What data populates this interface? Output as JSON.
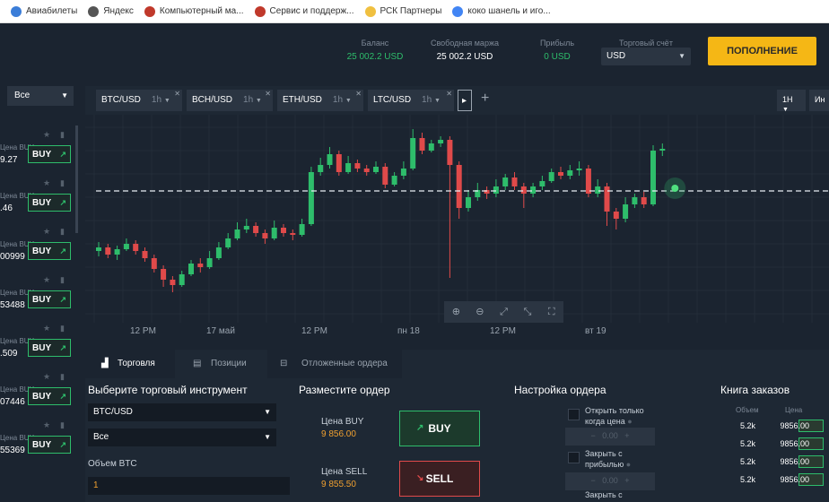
{
  "bookmarks": [
    {
      "label": "Авиабилеты",
      "color": "#3b7dd8"
    },
    {
      "label": "Яндекс",
      "color": "#555555"
    },
    {
      "label": "Компьютерный ма...",
      "color": "#c0392b"
    },
    {
      "label": "Сервис и поддерж...",
      "color": "#c0392b"
    },
    {
      "label": "РСК Партнеры",
      "color": "#f0c040"
    },
    {
      "label": "коко шанель и иго...",
      "color": "#4285f4"
    }
  ],
  "header": {
    "balance_label": "Баланс",
    "balance": "25 002.2 USD",
    "free_margin_label": "Свободная маржа",
    "free_margin": "25 002.2 USD",
    "profit_label": "Прибыль",
    "profit": "0 USD",
    "account_label": "Торговый счёт",
    "account": "USD",
    "topup": "ПОПОЛНЕНИЕ"
  },
  "left": {
    "filter": "Все",
    "rows": [
      {
        "label": "Цена BUY",
        "price": "9.27",
        "btn": "BUY"
      },
      {
        "label": "Цена BUY",
        "price": ".46",
        "btn": "BUY"
      },
      {
        "label": "Цена BUY",
        "price": "00999",
        "btn": "BUY"
      },
      {
        "label": "Цена BUY",
        "price": "53488",
        "btn": "BUY"
      },
      {
        "label": "Цена BUY",
        "price": ".509",
        "btn": "BUY"
      },
      {
        "label": "Цена BUY",
        "price": "07446",
        "btn": "BUY"
      },
      {
        "label": "Цена BUY",
        "price": "55369",
        "btn": "BUY"
      }
    ]
  },
  "chart_tabs": [
    {
      "pair": "BTC/USD",
      "tf": "1h"
    },
    {
      "pair": "BCH/USD",
      "tf": "1h"
    },
    {
      "pair": "ETH/USD",
      "tf": "1h"
    },
    {
      "pair": "LTC/USD",
      "tf": "1h"
    }
  ],
  "chart_right": {
    "tf": "1H",
    "ind": "Ин"
  },
  "chart_data": {
    "type": "candlestick",
    "x_ticks": [
      "12 PM",
      "17 май",
      "12 PM",
      "пн 18",
      "12 PM",
      "вт 19"
    ],
    "current_line": true,
    "candles": [
      [
        0.4,
        0.42,
        0.37,
        0.45
      ],
      [
        0.42,
        0.38,
        0.36,
        0.44
      ],
      [
        0.38,
        0.41,
        0.35,
        0.43
      ],
      [
        0.41,
        0.44,
        0.4,
        0.47
      ],
      [
        0.44,
        0.4,
        0.38,
        0.46
      ],
      [
        0.4,
        0.36,
        0.34,
        0.42
      ],
      [
        0.36,
        0.3,
        0.28,
        0.38
      ],
      [
        0.3,
        0.24,
        0.2,
        0.32
      ],
      [
        0.24,
        0.21,
        0.17,
        0.26
      ],
      [
        0.21,
        0.27,
        0.2,
        0.29
      ],
      [
        0.27,
        0.33,
        0.26,
        0.35
      ],
      [
        0.33,
        0.31,
        0.28,
        0.36
      ],
      [
        0.31,
        0.36,
        0.3,
        0.4
      ],
      [
        0.36,
        0.42,
        0.35,
        0.45
      ],
      [
        0.42,
        0.47,
        0.41,
        0.5
      ],
      [
        0.47,
        0.52,
        0.46,
        0.56
      ],
      [
        0.52,
        0.54,
        0.5,
        0.58
      ],
      [
        0.54,
        0.5,
        0.48,
        0.56
      ],
      [
        0.5,
        0.47,
        0.44,
        0.52
      ],
      [
        0.47,
        0.53,
        0.46,
        0.57
      ],
      [
        0.53,
        0.5,
        0.48,
        0.55
      ],
      [
        0.5,
        0.49,
        0.46,
        0.52
      ],
      [
        0.49,
        0.55,
        0.48,
        0.58
      ],
      [
        0.55,
        0.84,
        0.54,
        0.87
      ],
      [
        0.84,
        0.88,
        0.82,
        0.92
      ],
      [
        0.88,
        0.94,
        0.86,
        0.98
      ],
      [
        0.94,
        0.84,
        0.82,
        0.96
      ],
      [
        0.84,
        0.89,
        0.83,
        0.93
      ],
      [
        0.89,
        0.86,
        0.84,
        0.91
      ],
      [
        0.86,
        0.84,
        0.82,
        0.88
      ],
      [
        0.84,
        0.87,
        0.83,
        0.9
      ],
      [
        0.87,
        0.77,
        0.75,
        0.89
      ],
      [
        0.77,
        0.82,
        0.76,
        0.84
      ],
      [
        0.82,
        0.86,
        0.8,
        0.9
      ],
      [
        0.86,
        1.03,
        0.85,
        1.08
      ],
      [
        1.03,
        0.96,
        0.94,
        1.06
      ],
      [
        0.96,
        1.0,
        0.95,
        1.02
      ],
      [
        1.0,
        1.02,
        0.98,
        1.04
      ],
      [
        1.02,
        0.88,
        0.25,
        1.04
      ],
      [
        0.88,
        0.64,
        0.58,
        0.9
      ],
      [
        0.64,
        0.7,
        0.62,
        0.74
      ],
      [
        0.7,
        0.74,
        0.68,
        0.78
      ],
      [
        0.74,
        0.72,
        0.69,
        0.76
      ],
      [
        0.72,
        0.76,
        0.7,
        0.8
      ],
      [
        0.76,
        0.81,
        0.74,
        0.83
      ],
      [
        0.81,
        0.76,
        0.74,
        0.84
      ],
      [
        0.76,
        0.72,
        0.64,
        0.78
      ],
      [
        0.72,
        0.76,
        0.7,
        0.78
      ],
      [
        0.76,
        0.79,
        0.74,
        0.82
      ],
      [
        0.79,
        0.84,
        0.78,
        0.86
      ],
      [
        0.84,
        0.82,
        0.8,
        0.87
      ],
      [
        0.82,
        0.85,
        0.8,
        0.88
      ],
      [
        0.85,
        0.86,
        0.82,
        0.9
      ],
      [
        0.86,
        0.72,
        0.7,
        0.88
      ],
      [
        0.72,
        0.76,
        0.7,
        0.8
      ],
      [
        0.76,
        0.62,
        0.54,
        0.78
      ],
      [
        0.62,
        0.58,
        0.52,
        0.64
      ],
      [
        0.58,
        0.66,
        0.56,
        0.7
      ],
      [
        0.66,
        0.7,
        0.64,
        0.72
      ],
      [
        0.7,
        0.66,
        0.64,
        0.73
      ],
      [
        0.66,
        0.96,
        0.65,
        0.99
      ],
      [
        0.96,
        0.97,
        0.93,
        1.0
      ]
    ]
  },
  "bottom": {
    "tabs": [
      "Торговля",
      "Позиции",
      "Отложенные ордера"
    ],
    "instrument_title": "Выберите торговый инструмент",
    "instrument": "BTC/USD",
    "filter": "Все",
    "volume_label": "Объем BTC",
    "volume": "1",
    "order_title": "Разместите ордер",
    "buy_price_label": "Цена BUY",
    "buy_price": "9 856.00",
    "sell_price_label": "Цена SELL",
    "sell_price": "9 855.50",
    "buy": "BUY",
    "sell": "SELL",
    "settings_title": "Настройка ордера",
    "opt1": "Открыть только когда цена",
    "opt2": "Закрыть с прибылью",
    "opt3": "Закрыть с",
    "book_title": "Книга заказов",
    "book_h1": "Объем",
    "book_h2": "Цена",
    "book_rows": [
      {
        "vol": "5.2k",
        "price": "9856.00"
      },
      {
        "vol": "5.2k",
        "price": "9856.00"
      },
      {
        "vol": "5.2k",
        "price": "9856.00"
      },
      {
        "vol": "5.2k",
        "price": "9856.00"
      }
    ]
  }
}
